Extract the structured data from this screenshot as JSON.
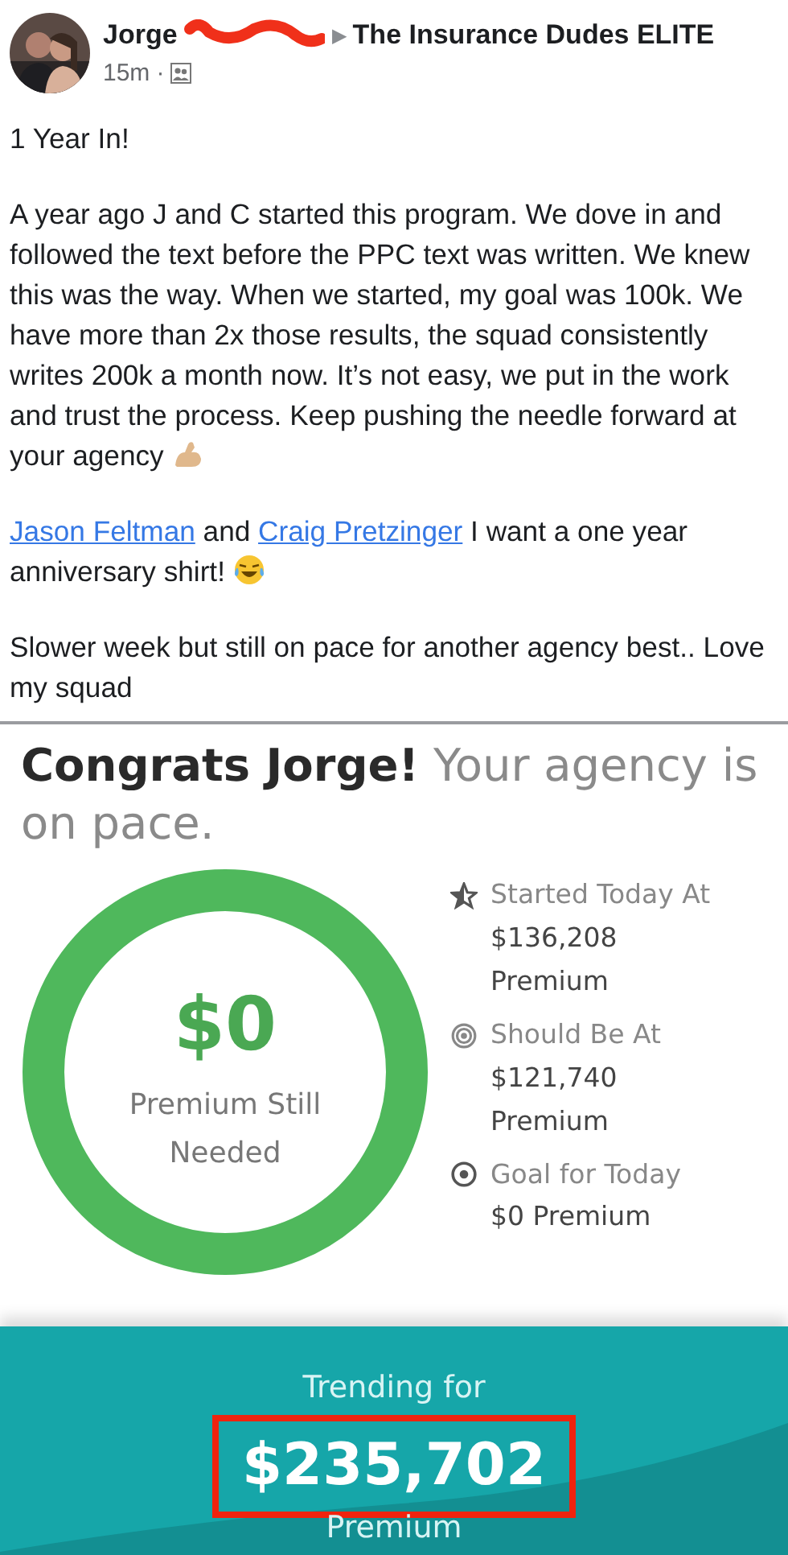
{
  "post": {
    "author": "Jorge",
    "redacted": true,
    "separator": "▶",
    "group": "The Insurance Dudes ELITE",
    "time": "15m",
    "dot": "·",
    "paragraphs": [
      [
        {
          "kind": "text",
          "text": "1 Year In!"
        }
      ],
      [
        {
          "kind": "text",
          "text": "A year ago J and C started this program. We dove in and followed the text before the PPC text was written. We knew this was the way. When we started, my goal was 100k. We have more than 2x those results, the squad consistently writes 200k a month now. It’s not easy, we put in the work and trust the process. Keep pushing the needle forward at your agency "
        },
        {
          "kind": "arm-emoji"
        }
      ],
      [
        {
          "kind": "mention",
          "text": "Jason Feltman"
        },
        {
          "kind": "text",
          "text": " and "
        },
        {
          "kind": "mention",
          "text": "Craig Pretzinger"
        },
        {
          "kind": "text",
          "text": " I want a one year anniversary shirt! "
        },
        {
          "kind": "laugh-emoji"
        }
      ],
      [
        {
          "kind": "text",
          "text": "Slower week but still on pace for another agency best.. Love my squad"
        }
      ]
    ]
  },
  "pace": {
    "title": "Congrats Jorge!",
    "subtitle": "Your agency is on pace.",
    "ring": {
      "amount": "$0",
      "caption": "Premium Still Needed"
    },
    "stats": [
      {
        "kind": "star",
        "label": "Started Today At",
        "value": "$136,208 Premium"
      },
      {
        "kind": "target",
        "label": "Should Be At",
        "value": "$121,740 Premium"
      },
      {
        "kind": "goal",
        "label": "Goal for Today",
        "value": "$0 Premium"
      }
    ],
    "trending": {
      "label": "Trending for",
      "amount": "$235,702",
      "unit": "Premium",
      "highlighted": true
    }
  }
}
